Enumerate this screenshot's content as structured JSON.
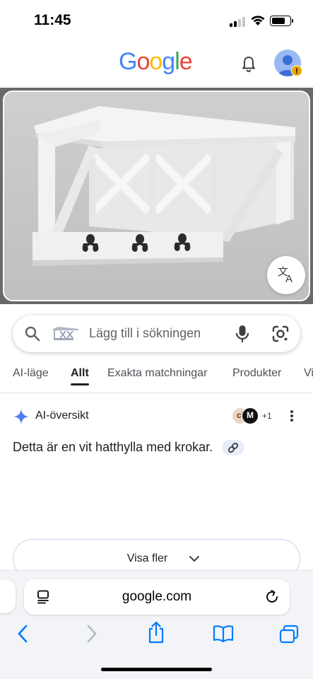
{
  "status_bar": {
    "time": "11:45",
    "signal_bars_filled": 2,
    "signal_bars_total": 4,
    "battery_level": 0.8
  },
  "header": {
    "logo_text": "Google",
    "logo_letters": [
      {
        "ch": "G",
        "color": "#4285f4"
      },
      {
        "ch": "o",
        "color": "#ea4335"
      },
      {
        "ch": "o",
        "color": "#fbbc05"
      },
      {
        "ch": "g",
        "color": "#4285f4"
      },
      {
        "ch": "l",
        "color": "#34a853"
      },
      {
        "ch": "e",
        "color": "#ea4335"
      }
    ],
    "notifications_icon": "bell-icon",
    "account_icon": "avatar-icon",
    "account_badge": "!"
  },
  "hero": {
    "image_subject": "white wall shelf with hooks",
    "translate_icon": "translate-icon"
  },
  "search": {
    "placeholder": "Lägg till i sökningen",
    "search_icon": "search-icon",
    "mic_icon": "mic-icon",
    "lens_icon": "lens-icon"
  },
  "tabs": [
    {
      "label": "AI-läge",
      "active": false
    },
    {
      "label": "Allt",
      "active": true
    },
    {
      "label": "Exakta matchningar",
      "active": false
    },
    {
      "label": "Produkter",
      "active": false
    },
    {
      "label": "Vi",
      "active": false
    }
  ],
  "ai_overview": {
    "title": "AI-översikt",
    "source_a": "cl",
    "source_b": "M",
    "source_count": "+1",
    "text": "Detta är en vit hatthylla med krokar.",
    "link_icon": "link-icon"
  },
  "show_more": {
    "label": "Visa fler"
  },
  "browser": {
    "url": "google.com",
    "reader_icon": "reader-icon",
    "reload_icon": "reload-icon",
    "back_icon": "back-icon",
    "forward_icon": "forward-icon",
    "share_icon": "share-icon",
    "bookmarks_icon": "bookmarks-icon",
    "tabs_icon": "tabs-icon"
  },
  "colors": {
    "google_blue": "#4285f4",
    "accent_link": "#1a73e8",
    "ios_blue": "#007aff"
  }
}
